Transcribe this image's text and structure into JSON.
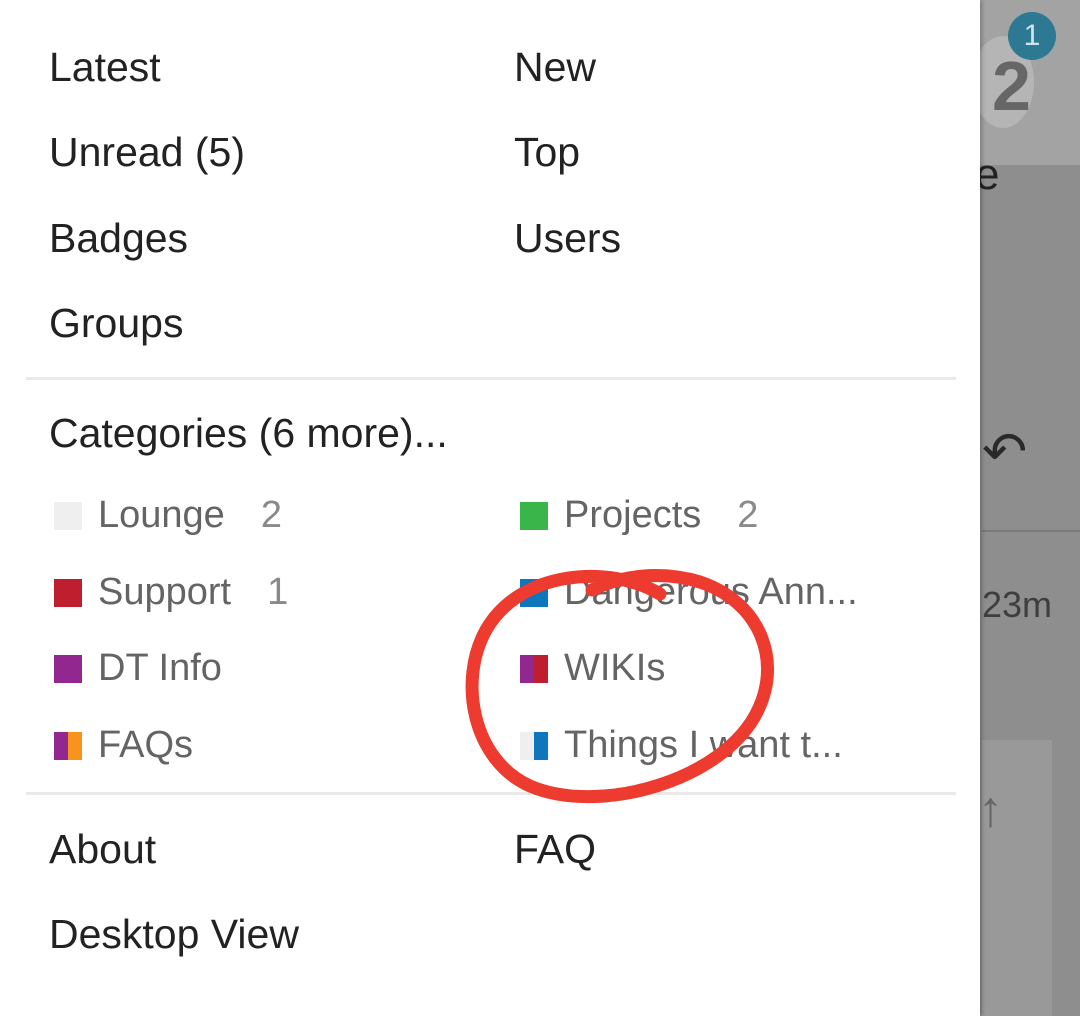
{
  "background": {
    "notification_count": "1",
    "avatar_digit": "2",
    "partial_text": "e",
    "time_text": "23m"
  },
  "menu": {
    "primary_links": [
      {
        "label": "Latest"
      },
      {
        "label": "New"
      },
      {
        "label": "Unread (5)"
      },
      {
        "label": "Top"
      },
      {
        "label": "Badges"
      },
      {
        "label": "Users"
      },
      {
        "label": "Groups"
      }
    ],
    "categories_heading": "Categories (6 more)...",
    "categories": [
      {
        "name": "Lounge",
        "count": "2",
        "colors": [
          "#efefef"
        ]
      },
      {
        "name": "Projects",
        "count": "2",
        "colors": [
          "#3ab54a"
        ]
      },
      {
        "name": "Support",
        "count": "1",
        "colors": [
          "#bf1e2e"
        ]
      },
      {
        "name": "Dangerous Ann...",
        "count": "",
        "colors": [
          "#0e76bd"
        ]
      },
      {
        "name": "DT Info",
        "count": "",
        "colors": [
          "#92278f"
        ]
      },
      {
        "name": "WIKIs",
        "count": "",
        "colors": [
          "#92278f",
          "#bf1e2e"
        ]
      },
      {
        "name": "FAQs",
        "count": "",
        "colors": [
          "#92278f",
          "#f7941d"
        ]
      },
      {
        "name": "Things I want t...",
        "count": "",
        "colors": [
          "#efefef",
          "#0e76bd"
        ]
      }
    ],
    "footer_links": [
      {
        "label": "About"
      },
      {
        "label": "FAQ"
      },
      {
        "label": "Desktop View"
      }
    ]
  },
  "annotation_color": "#ee3b2f"
}
